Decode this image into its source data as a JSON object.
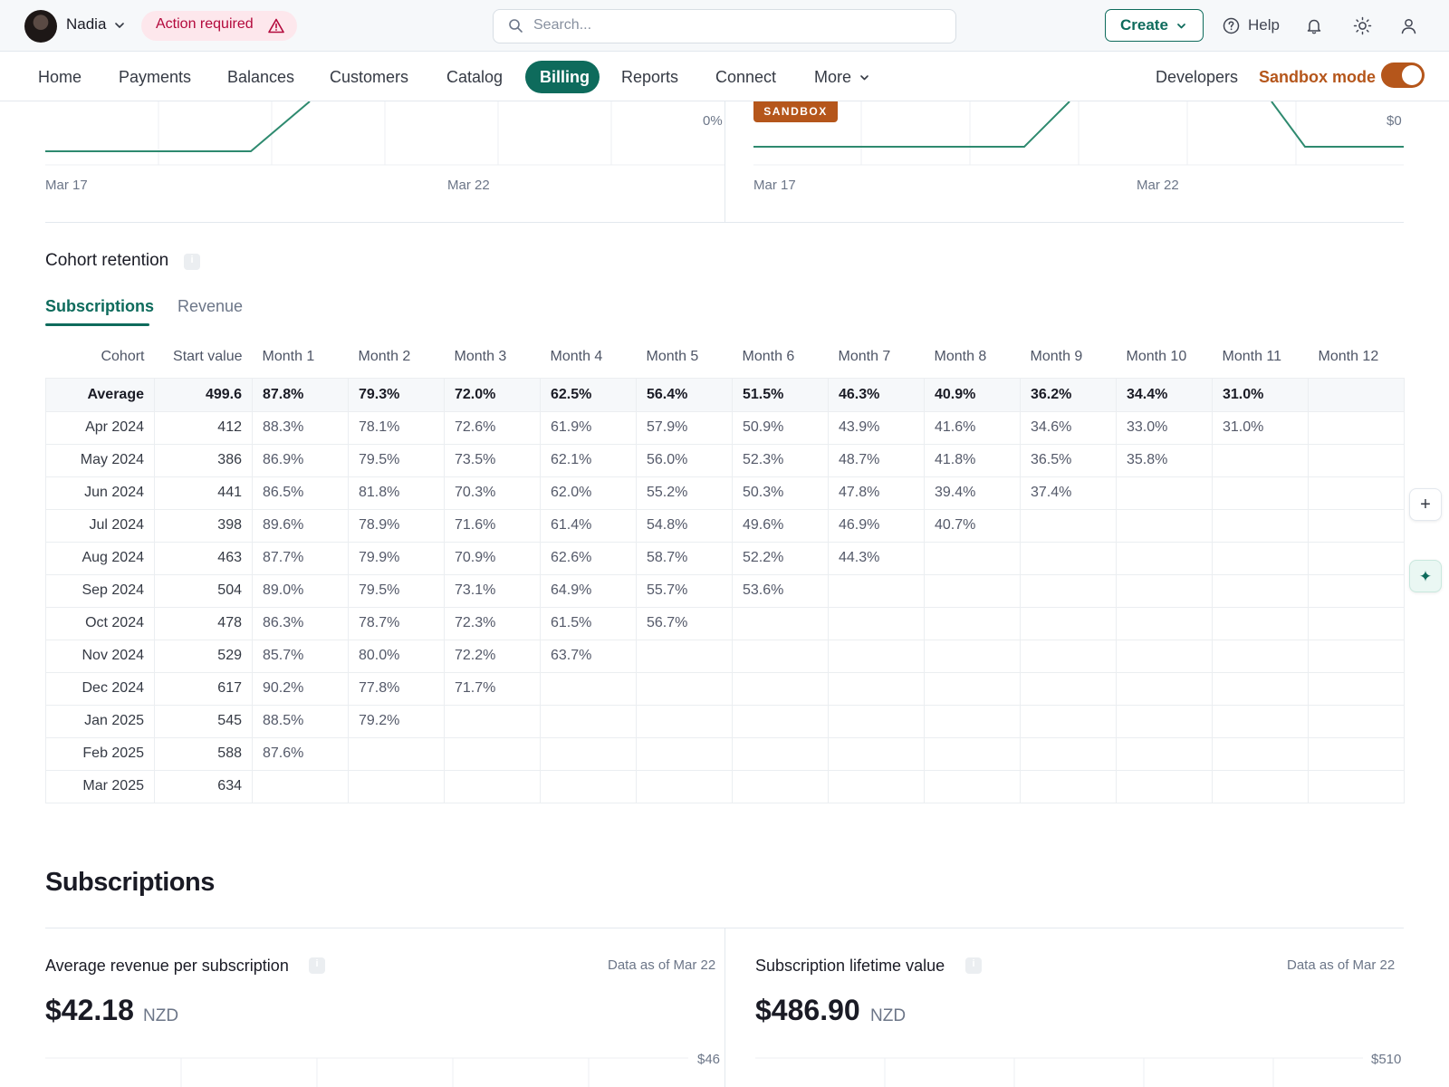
{
  "topbar": {
    "user_name": "Nadia",
    "action_required": "Action required",
    "search_placeholder": "Search...",
    "create_label": "Create",
    "help_label": "Help"
  },
  "nav": {
    "items": [
      "Home",
      "Payments",
      "Balances",
      "Customers",
      "Catalog",
      "Billing",
      "Reports",
      "Connect",
      "More"
    ],
    "active": "Billing",
    "developers_label": "Developers",
    "sandbox_mode_label": "Sandbox mode",
    "sandbox_mode_on": true
  },
  "top_charts": {
    "left": {
      "x_ticks": [
        "Mar 17",
        "Mar 22"
      ],
      "y_tick": "0%"
    },
    "right": {
      "badge": "SANDBOX",
      "x_ticks": [
        "Mar 17",
        "Mar 22"
      ],
      "y_tick": "$0"
    }
  },
  "cohort": {
    "title": "Cohort retention",
    "tabs": [
      "Subscriptions",
      "Revenue"
    ],
    "active_tab": "Subscriptions",
    "columns": [
      "Cohort",
      "Start value",
      "Month 1",
      "Month 2",
      "Month 3",
      "Month 4",
      "Month 5",
      "Month 6",
      "Month 7",
      "Month 8",
      "Month 9",
      "Month 10",
      "Month 11",
      "Month 12"
    ],
    "average": {
      "label": "Average",
      "start": "499.6",
      "months": [
        "87.8%",
        "79.3%",
        "72.0%",
        "62.5%",
        "56.4%",
        "51.5%",
        "46.3%",
        "40.9%",
        "36.2%",
        "34.4%",
        "31.0%",
        ""
      ]
    },
    "rows": [
      {
        "cohort": "Apr 2024",
        "start": "412",
        "months": [
          "88.3%",
          "78.1%",
          "72.6%",
          "61.9%",
          "57.9%",
          "50.9%",
          "43.9%",
          "41.6%",
          "34.6%",
          "33.0%",
          "31.0%"
        ]
      },
      {
        "cohort": "May 2024",
        "start": "386",
        "months": [
          "86.9%",
          "79.5%",
          "73.5%",
          "62.1%",
          "56.0%",
          "52.3%",
          "48.7%",
          "41.8%",
          "36.5%",
          "35.8%"
        ]
      },
      {
        "cohort": "Jun 2024",
        "start": "441",
        "months": [
          "86.5%",
          "81.8%",
          "70.3%",
          "62.0%",
          "55.2%",
          "50.3%",
          "47.8%",
          "39.4%",
          "37.4%"
        ]
      },
      {
        "cohort": "Jul 2024",
        "start": "398",
        "months": [
          "89.6%",
          "78.9%",
          "71.6%",
          "61.4%",
          "54.8%",
          "49.6%",
          "46.9%",
          "40.7%"
        ]
      },
      {
        "cohort": "Aug 2024",
        "start": "463",
        "months": [
          "87.7%",
          "79.9%",
          "70.9%",
          "62.6%",
          "58.7%",
          "52.2%",
          "44.3%"
        ]
      },
      {
        "cohort": "Sep 2024",
        "start": "504",
        "months": [
          "89.0%",
          "79.5%",
          "73.1%",
          "64.9%",
          "55.7%",
          "53.6%"
        ]
      },
      {
        "cohort": "Oct 2024",
        "start": "478",
        "months": [
          "86.3%",
          "78.7%",
          "72.3%",
          "61.5%",
          "56.7%"
        ]
      },
      {
        "cohort": "Nov 2024",
        "start": "529",
        "months": [
          "85.7%",
          "80.0%",
          "72.2%",
          "63.7%"
        ]
      },
      {
        "cohort": "Dec 2024",
        "start": "617",
        "months": [
          "90.2%",
          "77.8%",
          "71.7%"
        ]
      },
      {
        "cohort": "Jan 2025",
        "start": "545",
        "months": [
          "88.5%",
          "79.2%"
        ]
      },
      {
        "cohort": "Feb 2025",
        "start": "588",
        "months": [
          "87.6%"
        ]
      },
      {
        "cohort": "Mar 2025",
        "start": "634",
        "months": []
      }
    ]
  },
  "subscriptions": {
    "heading": "Subscriptions",
    "arps": {
      "title": "Average revenue per subscription",
      "as_of": "Data as of Mar 22",
      "value": "$42.18",
      "currency": "NZD",
      "y_tick": "$46"
    },
    "ltv": {
      "title": "Subscription lifetime value",
      "as_of": "Data as of Mar 22",
      "value": "$486.90",
      "currency": "NZD",
      "y_tick": "$510"
    }
  },
  "floating_actions": {
    "plus_glyph": "+",
    "spark_glyph": "✦"
  },
  "colors": {
    "brand": "#0e6b5c",
    "sandbox": "#b5561b",
    "alert": "#b3093c",
    "alert_bg": "#fde7ec"
  },
  "icons": [
    "avatar",
    "chevron-down-icon",
    "warning-icon",
    "search-icon",
    "help-icon",
    "bell-icon",
    "sun-icon",
    "person-icon",
    "info-icon",
    "plus-icon",
    "sparkle-icon"
  ]
}
